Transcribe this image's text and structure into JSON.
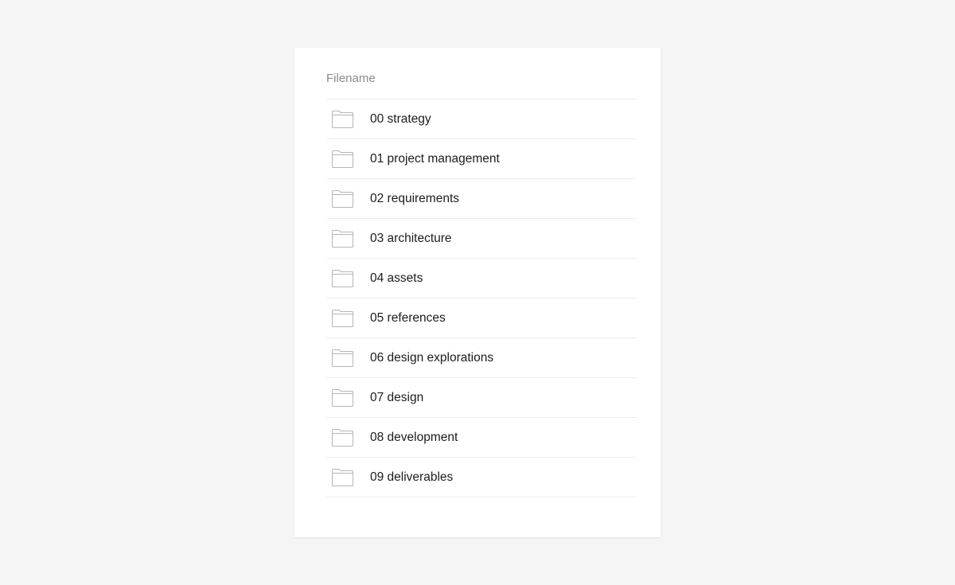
{
  "file_list": {
    "header": "Filename",
    "items": [
      {
        "label": "00 strategy",
        "icon": "folder-icon"
      },
      {
        "label": "01 project management",
        "icon": "folder-icon"
      },
      {
        "label": "02 requirements",
        "icon": "folder-icon"
      },
      {
        "label": "03 architecture",
        "icon": "folder-icon"
      },
      {
        "label": "04 assets",
        "icon": "folder-icon"
      },
      {
        "label": "05 references",
        "icon": "folder-icon"
      },
      {
        "label": "06 design explorations",
        "icon": "folder-icon"
      },
      {
        "label": "07 design",
        "icon": "folder-icon"
      },
      {
        "label": "08 development",
        "icon": "folder-icon"
      },
      {
        "label": "09 deliverables",
        "icon": "folder-icon"
      }
    ]
  },
  "colors": {
    "background": "#f5f5f5",
    "card": "#ffffff",
    "header_text": "#8a8a8a",
    "row_text": "#1c1c1c",
    "divider": "#ececec",
    "icon_stroke": "#b5b5b5"
  }
}
